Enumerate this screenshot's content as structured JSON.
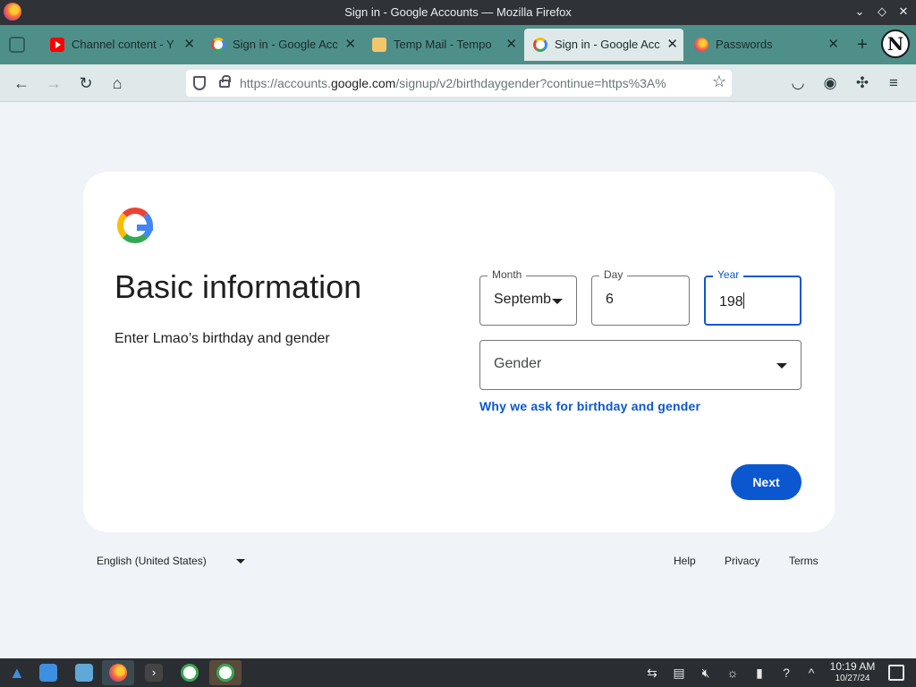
{
  "window": {
    "title": "Sign in - Google Accounts — Mozilla Firefox"
  },
  "tabs": [
    {
      "label": "Channel content - Y",
      "icon": "youtube-icon",
      "active": false
    },
    {
      "label": "Sign in - Google Acc",
      "icon": "google-icon",
      "active": false
    },
    {
      "label": "Temp Mail - Tempo",
      "icon": "mail-icon",
      "active": false
    },
    {
      "label": "Sign in - Google Acc",
      "icon": "google-icon",
      "active": true
    },
    {
      "label": "Passwords",
      "icon": "firefox-icon",
      "active": false
    }
  ],
  "profile": {
    "initial": "N"
  },
  "urlbar": {
    "prefix": "https://accounts.",
    "domain": "google.com",
    "path": "/signup/v2/birthdaygender?continue=https%3A%"
  },
  "page": {
    "heading": "Basic information",
    "subtext": "Enter Lmao’s birthday and gender",
    "month": {
      "label": "Month",
      "value": "Septemb"
    },
    "day": {
      "label": "Day",
      "value": "6"
    },
    "year": {
      "label": "Year",
      "value": "198"
    },
    "gender": {
      "placeholder": "Gender"
    },
    "why_link": "Why we ask for birthday and gender",
    "next_label": "Next"
  },
  "footer": {
    "language": "English (United States)",
    "help": "Help",
    "privacy": "Privacy",
    "terms": "Terms"
  },
  "taskbar": {
    "time": "10:19 AM",
    "date": "10/27/24"
  },
  "colors": {
    "accent": "#0b57d0",
    "page_bg": "#f0f4f9",
    "tabstrip": "#4f8f8a"
  }
}
